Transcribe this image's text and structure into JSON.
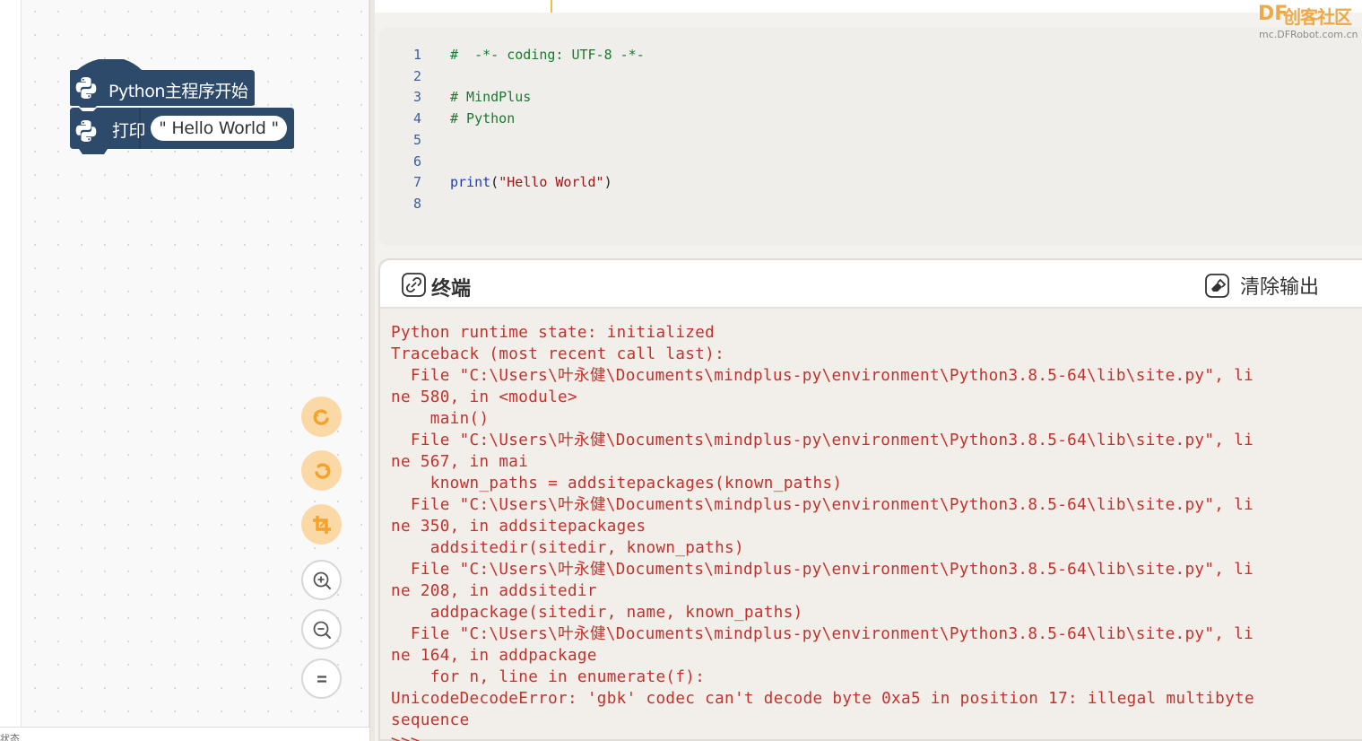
{
  "blocks": {
    "hat_label": "Python主程序开始",
    "print_label": "打印",
    "print_value": "\" Hello World \""
  },
  "workspace": {
    "bottom_text": "状态"
  },
  "tools": {
    "undo_icon": "undo-icon",
    "redo_icon": "redo-icon",
    "crop_icon": "crop-icon",
    "zoom_in_icon": "zoom-in-icon",
    "zoom_out_icon": "zoom-out-icon",
    "reset_icon": "equals-icon"
  },
  "editor": {
    "lines": [
      {
        "no": "1",
        "text": "#  -*- coding: UTF-8 -*-"
      },
      {
        "no": "2",
        "text": ""
      },
      {
        "no": "3",
        "text": "# MindPlus"
      },
      {
        "no": "4",
        "text": "# Python"
      },
      {
        "no": "5",
        "text": ""
      },
      {
        "no": "6",
        "text": ""
      },
      {
        "no": "7",
        "fn": "print",
        "open": "(",
        "str": "\"Hello World\"",
        "close": ")"
      },
      {
        "no": "8",
        "text": ""
      }
    ]
  },
  "terminal": {
    "title": "终端",
    "clear_label": "清除输出",
    "output": [
      "Python runtime state: initialized",
      "Traceback (most recent call last):",
      "  File \"C:\\Users\\叶永健\\Documents\\mindplus-py\\environment\\Python3.8.5-64\\lib\\site.py\", li",
      "ne 580, in <module>",
      "    main()",
      "  File \"C:\\Users\\叶永健\\Documents\\mindplus-py\\environment\\Python3.8.5-64\\lib\\site.py\", li",
      "ne 567, in mai",
      "    known_paths = addsitepackages(known_paths)",
      "  File \"C:\\Users\\叶永健\\Documents\\mindplus-py\\environment\\Python3.8.5-64\\lib\\site.py\", li",
      "ne 350, in addsitepackages",
      "    addsitedir(sitedir, known_paths)",
      "  File \"C:\\Users\\叶永健\\Documents\\mindplus-py\\environment\\Python3.8.5-64\\lib\\site.py\", li",
      "ne 208, in addsitedir",
      "    addpackage(sitedir, name, known_paths)",
      "  File \"C:\\Users\\叶永健\\Documents\\mindplus-py\\environment\\Python3.8.5-64\\lib\\site.py\", li",
      "ne 164, in addpackage",
      "    for n, line in enumerate(f):",
      "UnicodeDecodeError: 'gbk' codec can't decode byte 0xa5 in position 17: illegal multibyte",
      "sequence",
      ">>>"
    ]
  },
  "watermark": {
    "df": "DF",
    "cn": "创客社区",
    "url": "mc.DFRobot.com.cn"
  },
  "colors": {
    "block_blue": "#2d4a6b",
    "accent_orange": "#f5b84c",
    "terminal_red": "#c5302a"
  }
}
